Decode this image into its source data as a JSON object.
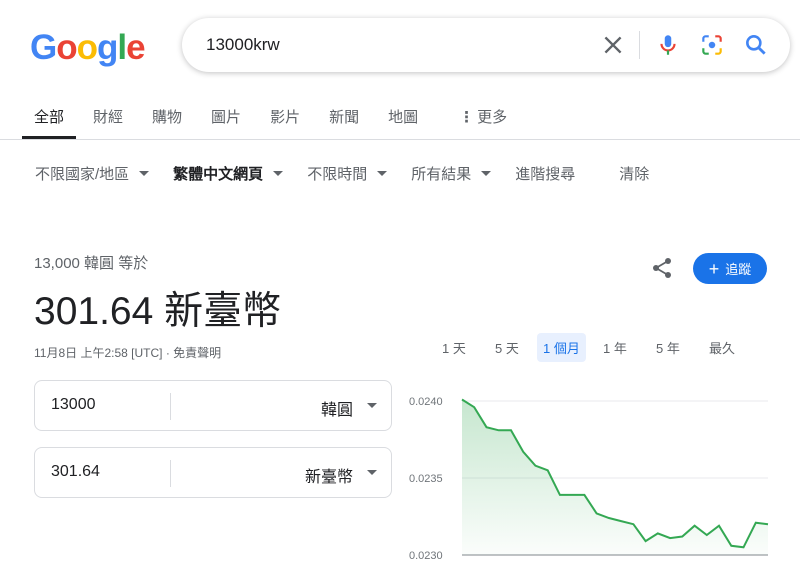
{
  "logo": {
    "letters": [
      "G",
      "o",
      "o",
      "g",
      "l",
      "e"
    ],
    "colors": [
      "#4285F4",
      "#EA4335",
      "#FBBC05",
      "#4285F4",
      "#34A853",
      "#EA4335"
    ]
  },
  "search": {
    "query": "13000krw",
    "icons": [
      "close-icon",
      "mic-icon",
      "lens-icon",
      "search-icon"
    ]
  },
  "tabs": [
    {
      "label": "全部",
      "active": true
    },
    {
      "label": "財經",
      "active": false
    },
    {
      "label": "購物",
      "active": false
    },
    {
      "label": "圖片",
      "active": false
    },
    {
      "label": "影片",
      "active": false
    },
    {
      "label": "新聞",
      "active": false
    },
    {
      "label": "地圖",
      "active": false
    },
    {
      "label": "更多",
      "active": false
    }
  ],
  "filters": [
    {
      "label": "不限國家/地區",
      "dropdown": true
    },
    {
      "label": "繁體中文網頁",
      "dropdown": true
    },
    {
      "label": "不限時間",
      "dropdown": true
    },
    {
      "label": "所有結果",
      "dropdown": true
    },
    {
      "label": "進階搜尋",
      "dropdown": false
    },
    {
      "label": "清除",
      "dropdown": false
    }
  ],
  "converter": {
    "equals_text": "13,000 韓圓 等於",
    "result_text": "301.64 新臺幣",
    "timestamp": "11月8日 上午2:58 [UTC] · 免責聲明",
    "follow_label": "追蹤",
    "from": {
      "value": "13000",
      "currency": "韓圓"
    },
    "to": {
      "value": "301.64",
      "currency": "新臺幣"
    }
  },
  "range_tabs": [
    {
      "label": "1 天",
      "active": false
    },
    {
      "label": "5 天",
      "active": false
    },
    {
      "label": "1 個月",
      "active": true
    },
    {
      "label": "1 年",
      "active": false
    },
    {
      "label": "5 年",
      "active": false
    },
    {
      "label": "最久",
      "active": false
    }
  ],
  "colors": {
    "accent": "#1a73e8",
    "line": "#34a853"
  },
  "chart_data": {
    "type": "area",
    "ytick_labels": [
      "0.0240",
      "0.0235",
      "0.0230"
    ],
    "yticks": [
      0.024,
      0.0235,
      0.023
    ],
    "ylim": [
      0.023,
      0.024
    ],
    "values": [
      0.02401,
      0.02396,
      0.02383,
      0.02381,
      0.02381,
      0.02367,
      0.02358,
      0.02355,
      0.02339,
      0.02339,
      0.02339,
      0.02327,
      0.02324,
      0.02322,
      0.0232,
      0.02309,
      0.02314,
      0.02311,
      0.02312,
      0.02319,
      0.02313,
      0.02319,
      0.02306,
      0.02305,
      0.02321,
      0.0232
    ],
    "grid": true
  }
}
